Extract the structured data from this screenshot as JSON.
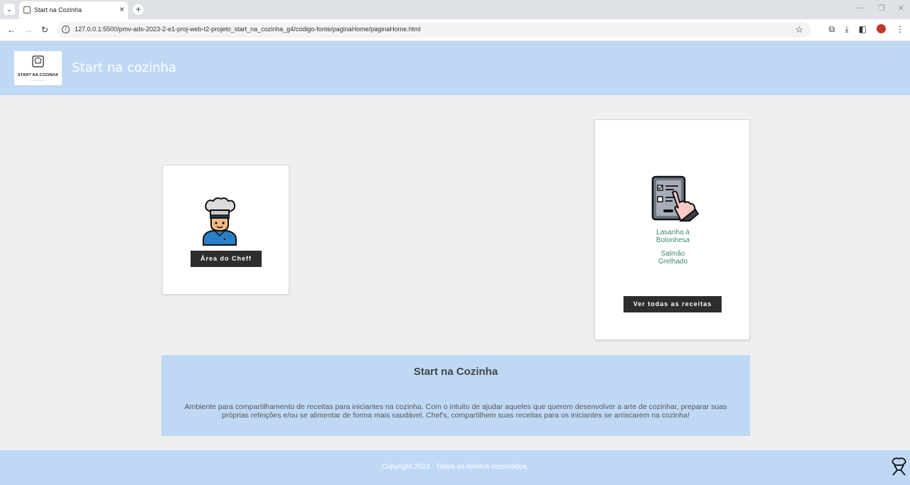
{
  "browser": {
    "tab_title": "Start na Cozinha",
    "url": "127.0.0.1:5500/pmv-ads-2023-2-e1-proj-web-t2-projeto_start_na_cozinha_g4/codigo-fonte/paginaHome/paginaHome.html"
  },
  "header": {
    "logo_text": "START NA COZINHA",
    "title": "Start na cozinha"
  },
  "chef_card": {
    "button_label": "Área do Cheff"
  },
  "recipes_card": {
    "recipes": [
      "Lasanha à Bolonhesa",
      "Salmão Grelhado"
    ],
    "button_label": "Ver todas as receitas"
  },
  "about": {
    "title": "Start na Cozinha",
    "text": "Ambiente para compartilhamento de receitas para iniciantes na cozinha. Com o intuito de ajudar aqueles que querem desenvolver a arte de cozinhar, preparar suas próprias refeições e/ou se alimentar de forma mais saudável. Chef's, compartilhem suas receitas para os iniciantes se arriscarem na cozinha!"
  },
  "footer": {
    "copyright": "Copyright 2023 - Todos os direitos reservados."
  },
  "colors": {
    "accent": "#bfd9f5",
    "button": "#2d2d2d",
    "link": "#3f8a6a",
    "background": "#efefef"
  }
}
